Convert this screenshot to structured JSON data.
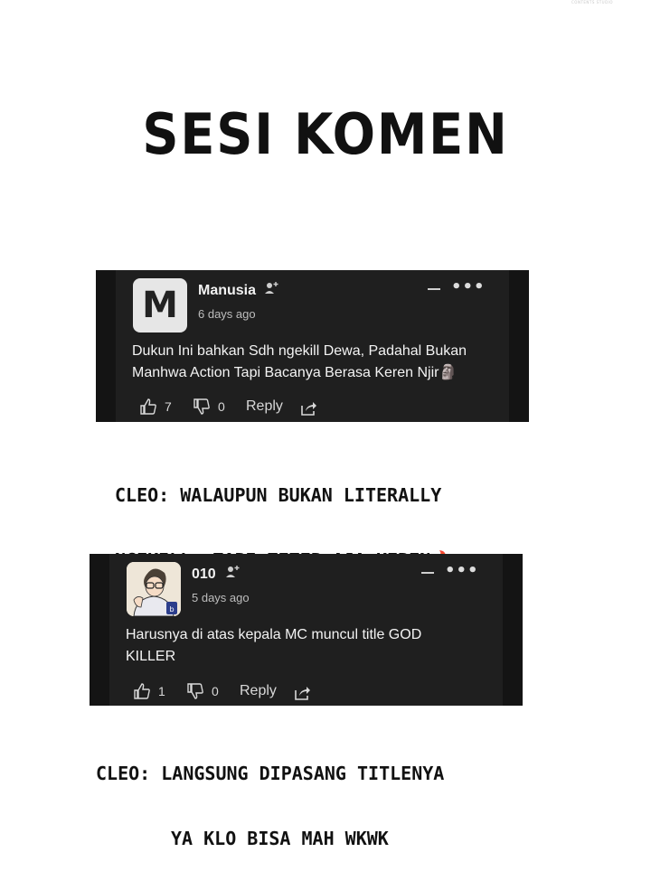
{
  "watermark": "CONTENTS STUDIO",
  "title": "SESI KOMEN",
  "comments": [
    {
      "avatar_letter": "M",
      "username": "Manusia",
      "time": "6 days ago",
      "text_lines": [
        "Dukun Ini bahkan Sdh ngekill Dewa, Padahal Bukan",
        "Manhwa Action Tapi Bacanya Berasa Keren Njir🗿"
      ],
      "likes": "7",
      "dislikes": "0",
      "reply": "Reply"
    },
    {
      "username": "010",
      "time": "5 days ago",
      "text_lines": [
        "Harusnya di atas kepala MC muncul title GOD",
        "KILLER"
      ],
      "likes": "1",
      "dislikes": "0",
      "reply": "Reply"
    }
  ],
  "captions": [
    [
      "CLEO: WALAUPUN BUKAN LITERALLY",
      "NGEKILL, TAPI TETEP AJA KEREN🔥"
    ],
    [
      "CLEO: LANGSUNG DIPASANG TITLENYA",
      "YA KLO BISA MAH WKWK"
    ]
  ]
}
